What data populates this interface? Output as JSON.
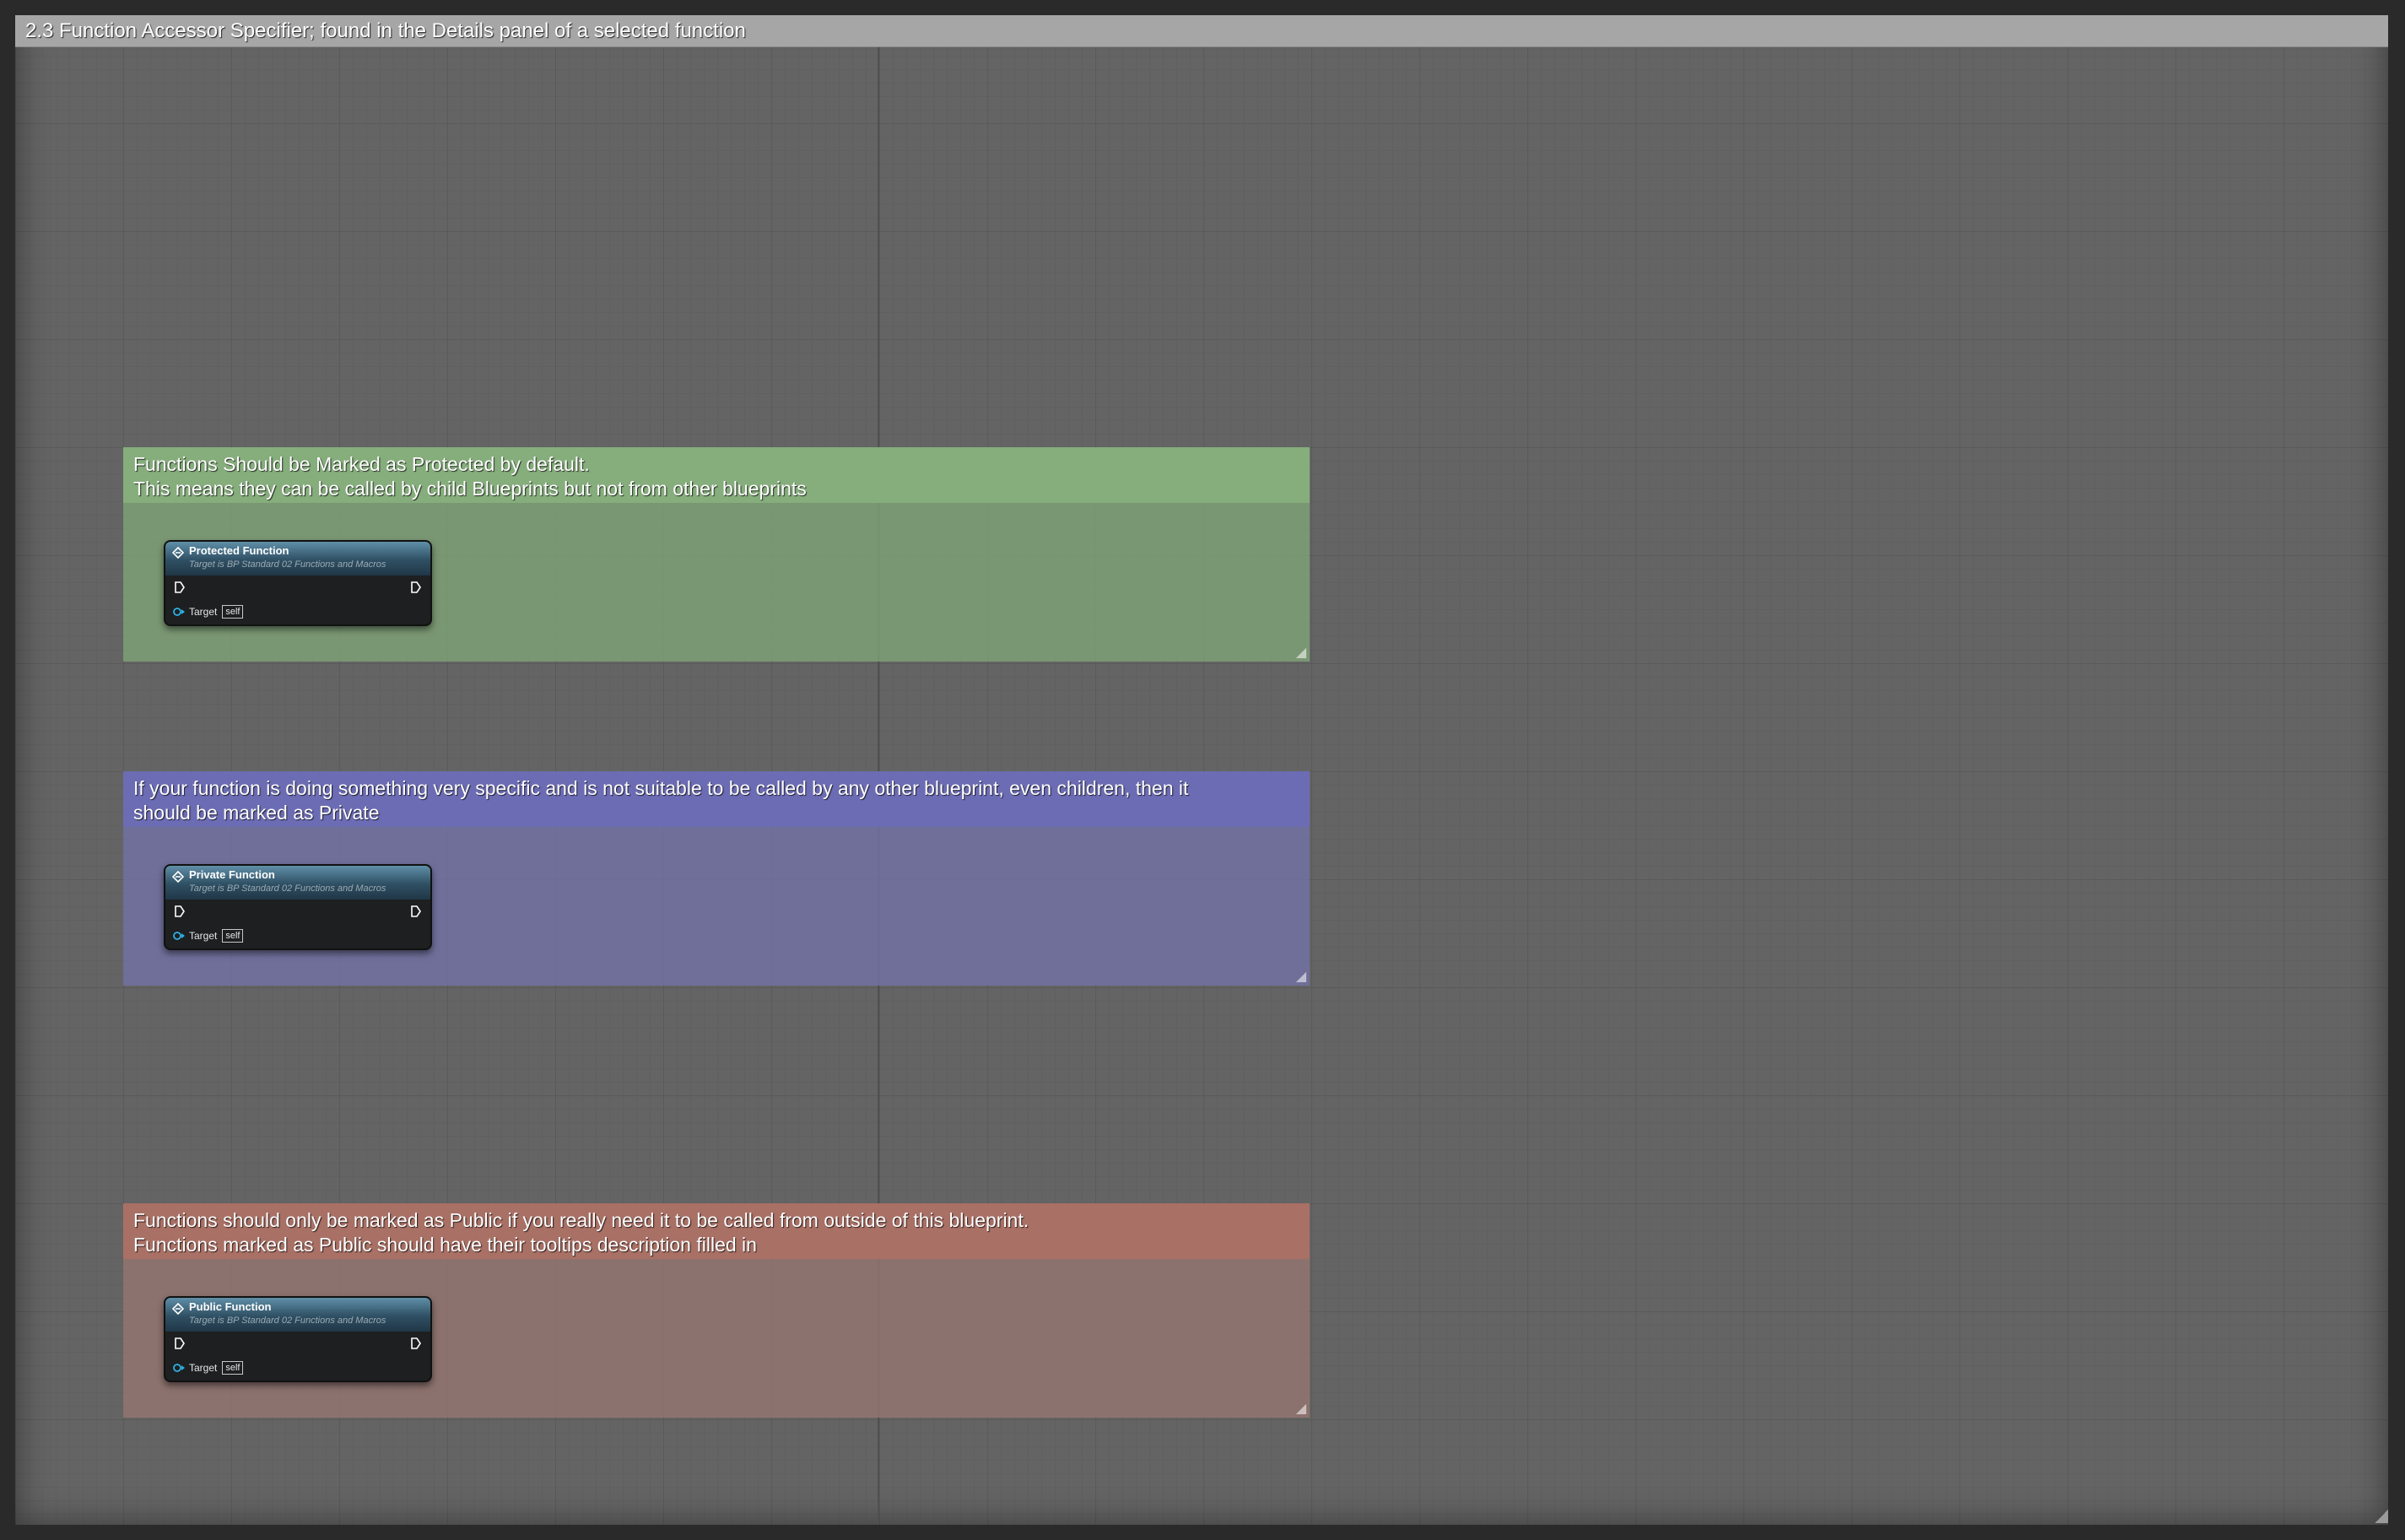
{
  "frame": {
    "title": "2.3 Function Accessor Specifier; found in the Details panel of a selected function"
  },
  "comments": [
    {
      "color": "#86ad7c",
      "lines": [
        "Functions Should be Marked as Protected by default.",
        "This means they can be called by child Blueprints but not from other blueprints"
      ],
      "node": {
        "title": "Protected Function",
        "subtitle": "Target is BP Standard 02 Functions and Macros",
        "target_label": "Target",
        "target_value": "self",
        "icon": "function-icon"
      }
    },
    {
      "color": "#6c6cb4",
      "lines": [
        "If your function is doing something very specific and is not suitable to be called by any other blueprint, even children, then it",
        "should be marked as Private"
      ],
      "node": {
        "title": "Private Function",
        "subtitle": "Target is BP Standard 02 Functions and Macros",
        "target_label": "Target",
        "target_value": "self",
        "icon": "function-icon"
      }
    },
    {
      "color": "#a97065",
      "lines": [
        "Functions should only be marked as Public if you really need it to be called from outside of this blueprint.",
        "Functions marked as Public should have their tooltips description filled in"
      ],
      "node": {
        "title": "Public Function",
        "subtitle": "Target is BP Standard 02 Functions and Macros",
        "target_label": "Target",
        "target_value": "self",
        "icon": "function-icon"
      }
    }
  ]
}
